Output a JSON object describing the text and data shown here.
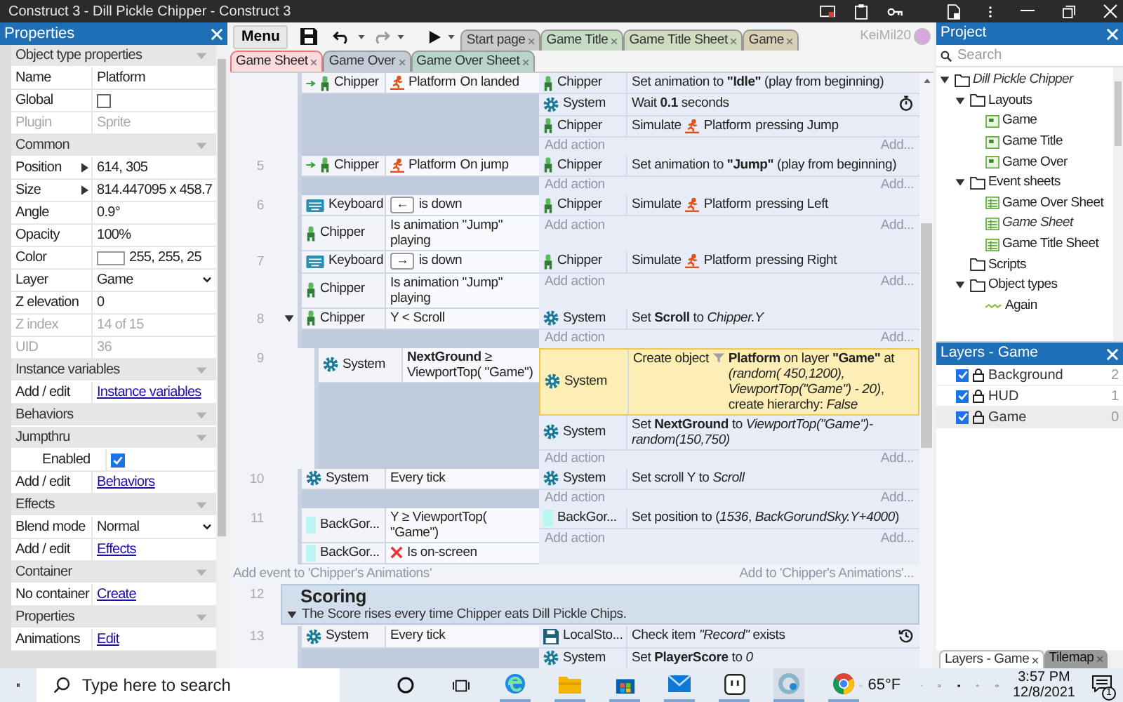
{
  "window": {
    "title": "Construct 3 - Dill Pickle Chipper - Construct 3"
  },
  "properties": {
    "title": "Properties",
    "rows": [
      {
        "kind": "section",
        "label": "Object type properties"
      },
      {
        "kind": "text",
        "label": "Name",
        "value": "Platform",
        "disabled": false
      },
      {
        "kind": "check",
        "label": "Global",
        "checked": false,
        "disabled": false
      },
      {
        "kind": "text",
        "label": "Plugin",
        "value": "Sprite",
        "disabled": true
      },
      {
        "kind": "section",
        "label": "Common"
      },
      {
        "kind": "expand",
        "label": "Position",
        "value": "614, 305",
        "disabled": false
      },
      {
        "kind": "expand",
        "label": "Size",
        "value": "814.447095 x 458.7",
        "disabled": false
      },
      {
        "kind": "text",
        "label": "Angle",
        "value": "0.9°",
        "disabled": false
      },
      {
        "kind": "text",
        "label": "Opacity",
        "value": "100%",
        "disabled": false
      },
      {
        "kind": "swatch",
        "label": "Color",
        "value": "255, 255, 25",
        "color": "#ffffff",
        "disabled": false
      },
      {
        "kind": "dropdown",
        "label": "Layer",
        "value": "Game",
        "disabled": false
      },
      {
        "kind": "text",
        "label": "Z elevation",
        "value": "0",
        "disabled": false
      },
      {
        "kind": "text",
        "label": "Z index",
        "value": "14 of 15",
        "disabled": true
      },
      {
        "kind": "text",
        "label": "UID",
        "value": "36",
        "disabled": true
      },
      {
        "kind": "section",
        "label": "Instance variables"
      },
      {
        "kind": "link",
        "label": "Add / edit",
        "value": "Instance variables",
        "disabled": false
      },
      {
        "kind": "section",
        "label": "Behaviors"
      },
      {
        "kind": "section",
        "label": "Jumpthru",
        "children": [
          {
            "kind": "check",
            "label": "Enabled",
            "checked": true,
            "disabled": false
          }
        ]
      },
      {
        "kind": "link",
        "label": "Add / edit",
        "value": "Behaviors",
        "disabled": false
      },
      {
        "kind": "section",
        "label": "Effects"
      },
      {
        "kind": "dropdown",
        "label": "Blend mode",
        "value": "Normal",
        "disabled": false
      },
      {
        "kind": "link",
        "label": "Add / edit",
        "value": "Effects",
        "disabled": false
      },
      {
        "kind": "section",
        "label": "Container"
      },
      {
        "kind": "link",
        "label": "No container",
        "value": "Create",
        "disabled": false
      },
      {
        "kind": "section",
        "label": "Properties"
      },
      {
        "kind": "link",
        "label": "Animations",
        "value": "Edit",
        "disabled": false
      }
    ]
  },
  "toolbar": {
    "menu": "Menu"
  },
  "tabs": [
    {
      "label": "Start page",
      "color": "#c9c9c9",
      "selected": false
    },
    {
      "label": "Game Title",
      "color": "#c6dcc4",
      "selected": false
    },
    {
      "label": "Game Title Sheet",
      "color": "#cfdcbf",
      "selected": false
    },
    {
      "label": "Game",
      "color": "#d8cfb5",
      "selected": false
    },
    {
      "label": "Game Sheet",
      "color": "#fadadd",
      "selected": true
    },
    {
      "label": "Game Over",
      "color": "#c4ccd8",
      "selected": false
    },
    {
      "label": "Game Over Sheet",
      "color": "#b8d4cb",
      "selected": false
    }
  ],
  "user": "KeiMil20",
  "events": [
    {
      "kind": "event",
      "trigger": true,
      "expanded": false,
      "conditions": [
        {
          "object": "Chipper",
          "kind": "sprite",
          "inverted": false,
          "behavior": "Platform",
          "text": "On landed"
        }
      ],
      "actions": [
        {
          "object": "Chipper",
          "kind": "sprite",
          "text": "Set animation to **\"Idle\"** (play from beginning)",
          "async": false,
          "looping": false,
          "selected": false
        },
        {
          "object": "System",
          "kind": "system",
          "text": "Wait **0.1** seconds",
          "async": true,
          "looping": false,
          "selected": false
        },
        {
          "object": "Chipper",
          "kind": "sprite",
          "lead": "Simulate",
          "behavior": "Platform",
          "text": "pressing Jump",
          "async": false,
          "looping": false,
          "selected": false
        }
      ],
      "add_action": "Add action",
      "add_more": "Add..."
    },
    {
      "kind": "event",
      "number": "5",
      "trigger": true,
      "expanded": false,
      "conditions": [
        {
          "object": "Chipper",
          "kind": "sprite",
          "inverted": false,
          "behavior": "Platform",
          "text": "On jump"
        }
      ],
      "actions": [
        {
          "object": "Chipper",
          "kind": "sprite",
          "text": "Set animation to **\"Jump\"** (play from beginning)",
          "async": false,
          "looping": false,
          "selected": false
        }
      ],
      "add_action": "Add action",
      "add_more": "Add..."
    },
    {
      "kind": "event",
      "number": "6",
      "trigger": false,
      "expanded": false,
      "conditions": [
        {
          "object": "Keyboard",
          "kind": "keyboard",
          "inverted": false,
          "key": "←",
          "text": "is down"
        },
        {
          "object": "Chipper",
          "kind": "sprite",
          "inverted": false,
          "text": "Is animation \"Jump\" playing"
        }
      ],
      "actions": [
        {
          "object": "Chipper",
          "kind": "sprite",
          "lead": "Simulate",
          "behavior": "Platform",
          "text": "pressing Left",
          "async": false,
          "looping": false,
          "selected": false
        }
      ],
      "add_action": "Add action",
      "add_more": "Add..."
    },
    {
      "kind": "event",
      "number": "7",
      "trigger": false,
      "expanded": false,
      "conditions": [
        {
          "object": "Keyboard",
          "kind": "keyboard",
          "inverted": false,
          "key": "→",
          "text": "is down"
        },
        {
          "object": "Chipper",
          "kind": "sprite",
          "inverted": false,
          "text": "Is animation \"Jump\" playing"
        }
      ],
      "actions": [
        {
          "object": "Chipper",
          "kind": "sprite",
          "lead": "Simulate",
          "behavior": "Platform",
          "text": "pressing Right",
          "async": false,
          "looping": false,
          "selected": false
        }
      ],
      "add_action": "Add action",
      "add_more": "Add..."
    },
    {
      "kind": "event",
      "number": "8",
      "trigger": false,
      "expanded": true,
      "conditions": [
        {
          "object": "Chipper",
          "kind": "sprite",
          "inverted": false,
          "text": "Y < Scroll"
        }
      ],
      "actions": [
        {
          "object": "System",
          "kind": "system",
          "text": "Set **Scroll** to *Chipper.Y*",
          "async": false,
          "looping": false,
          "selected": false
        }
      ],
      "add_action": "Add action",
      "add_more": "Add...",
      "children": [
        {
          "kind": "event",
          "number": "9",
          "trigger": false,
          "expanded": false,
          "conditions": [
            {
              "object": "System",
              "kind": "system",
              "inverted": false,
              "text": "**NextGround** ≥ ViewportTop( \"Game\")"
            }
          ],
          "actions": [
            {
              "object": "System",
              "kind": "system",
              "lead": "Create object",
              "target": "Platform",
              "text": "on layer **\"Game\"** at *(random( 450,1200), ViewportTop(\"Game\") - 20)*, create hierarchy: *False*",
              "async": false,
              "looping": false,
              "selected": true
            },
            {
              "object": "System",
              "kind": "system",
              "text": "Set **NextGround** to *ViewportTop(\"Game\")-random(150,750)*",
              "async": false,
              "looping": false,
              "selected": false
            }
          ],
          "add_action": "Add action",
          "add_more": "Add..."
        }
      ]
    },
    {
      "kind": "event",
      "number": "10",
      "trigger": false,
      "expanded": false,
      "conditions": [
        {
          "object": "System",
          "kind": "system",
          "inverted": false,
          "text": "Every tick"
        }
      ],
      "actions": [
        {
          "object": "System",
          "kind": "system",
          "text": "Set scroll Y to *Scroll*",
          "async": false,
          "looping": false,
          "selected": false
        }
      ],
      "add_action": "Add action",
      "add_more": "Add..."
    },
    {
      "kind": "event",
      "number": "11",
      "trigger": false,
      "expanded": false,
      "conditions": [
        {
          "object": "BackGor...",
          "kind": "tiled",
          "inverted": false,
          "text": "Y ≥ ViewportTop( \"Game\")"
        },
        {
          "object": "BackGor...",
          "kind": "tiled",
          "inverted": true,
          "text": "Is on-screen"
        }
      ],
      "actions": [
        {
          "object": "BackGor...",
          "kind": "tiled",
          "text": "Set position to (*1536*, *BackGorundSky.Y+4000*)",
          "async": false,
          "looping": false,
          "selected": false
        }
      ],
      "add_action": "Add action",
      "add_more": "Add..."
    },
    {
      "kind": "add_event",
      "text": "Add event to 'Chipper's Animations'",
      "right": "Add to 'Chipper's Animations'..."
    },
    {
      "kind": "group",
      "number": "12",
      "title": "Scoring",
      "description": "The Score rises every time Chipper eats Dill Pickle Chips.",
      "expanded": true
    },
    {
      "kind": "event",
      "number": "13",
      "trigger": false,
      "expanded": false,
      "conditions": [
        {
          "object": "System",
          "kind": "system",
          "inverted": false,
          "text": "Every tick"
        }
      ],
      "actions": [
        {
          "object": "LocalSto...",
          "kind": "storage",
          "text": "Check item *\"Record\"* exists",
          "async": false,
          "looping": true,
          "selected": false
        },
        {
          "object": "System",
          "kind": "system",
          "text": "Set **PlayerScore** to *0*",
          "async": false,
          "looping": false,
          "selected": false
        }
      ]
    }
  ],
  "project": {
    "title": "Project",
    "search": {
      "placeholder": "Search"
    },
    "tree": [
      {
        "label": "Dill Pickle Chipper",
        "kind": "folder",
        "active": true,
        "expanded": true,
        "children": [
          {
            "label": "Layouts",
            "kind": "folder",
            "active": false,
            "expanded": true,
            "children": [
              {
                "label": "Game",
                "kind": "layout",
                "active": false
              },
              {
                "label": "Game Title",
                "kind": "layout",
                "active": false
              },
              {
                "label": "Game Over",
                "kind": "layout",
                "active": false
              }
            ]
          },
          {
            "label": "Event sheets",
            "kind": "folder",
            "active": false,
            "expanded": true,
            "children": [
              {
                "label": "Game Over Sheet",
                "kind": "sheet",
                "active": false
              },
              {
                "label": "Game Sheet",
                "kind": "sheet",
                "active": true
              },
              {
                "label": "Game Title Sheet",
                "kind": "sheet",
                "active": false
              }
            ]
          },
          {
            "label": "Scripts",
            "kind": "folder",
            "active": false
          },
          {
            "label": "Object types",
            "kind": "folder",
            "active": false,
            "expanded": true,
            "children": [
              {
                "label": "Again",
                "kind": "object",
                "active": false
              }
            ]
          }
        ]
      }
    ]
  },
  "layers": {
    "title": "Layers - Game",
    "items": [
      {
        "name": "Background",
        "count": "2",
        "visible": true,
        "selected": false
      },
      {
        "name": "HUD",
        "count": "1",
        "visible": true,
        "selected": false
      },
      {
        "name": "Game",
        "count": "0",
        "visible": true,
        "selected": true
      }
    ]
  },
  "bottom_tabs": [
    {
      "label": "Layers - Game",
      "selected": true
    },
    {
      "label": "Tilemap",
      "selected": false
    }
  ],
  "taskbar": {
    "search": {
      "placeholder": "Type here to search"
    },
    "temperature": "65°F",
    "time": "3:57 PM",
    "date": "12/8/2021",
    "notifications": "1"
  }
}
